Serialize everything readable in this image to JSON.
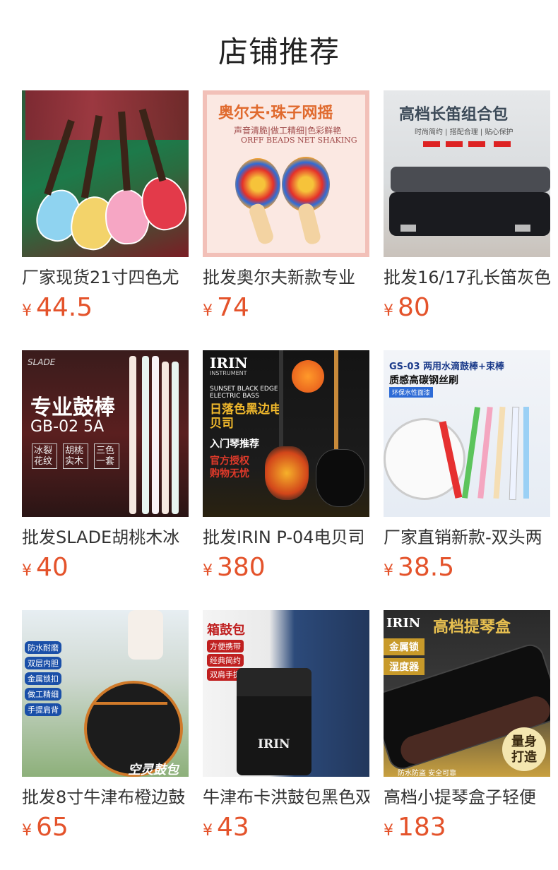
{
  "header": {
    "title": "店铺推荐"
  },
  "currency": "¥",
  "products": [
    {
      "name": "厂家现货21寸四色尤",
      "price": "44.5"
    },
    {
      "name": "批发奥尔夫新款专业",
      "price": "74",
      "image_text": {
        "headline": "奥尔夫·珠子网摇",
        "sub": "声音清脆|做工精细|色彩鲜艳",
        "en": "ORFF BEADS NET SHAKING"
      }
    },
    {
      "name": "批发16/17孔长笛灰色",
      "price": "80",
      "image_text": {
        "headline": "高档长笛组合包",
        "sub": "时尚简约 | 搭配合理 | 贴心保护"
      }
    },
    {
      "name": "批发SLADE胡桃木冰",
      "price": "40",
      "image_text": {
        "brand": "SLADE",
        "headline": "专业鼓棒",
        "model": "GB-02 5A",
        "tags": [
          "冰裂花纹",
          "胡桃实木",
          "三色一套"
        ]
      }
    },
    {
      "name": "批发IRIN P-04电贝司",
      "price": "380",
      "image_text": {
        "brand": "IRIN",
        "brand_sub": "INSTRUMENT",
        "en1": "SUNSET BLACK EDGE",
        "en2": "ELECTRIC BASS",
        "headline": "日落色黑边电贝司",
        "tag": "入门琴推荐",
        "note": "官方授权 购物无忧"
      }
    },
    {
      "name": "厂家直销新款-双头两",
      "price": "38.5",
      "image_text": {
        "headline": "GS-03 两用水滴鼓棒+束棒",
        "sub": "质感高碳钢丝刷",
        "tag": "环保水性面漆"
      }
    },
    {
      "name": "批发8寸牛津布橙边鼓",
      "price": "65",
      "image_text": {
        "tags": [
          "防水耐磨",
          "双层内胆",
          "金属锁扣",
          "做工精细",
          "手提肩背"
        ],
        "brand": "空灵鼓包"
      }
    },
    {
      "name": "牛津布卡洪鼓包黑色双",
      "price": "43",
      "image_text": {
        "headline": "箱鼓包",
        "tags": [
          "方便携带",
          "经典简约",
          "双肩手提"
        ],
        "brand": "IRIN"
      }
    },
    {
      "name": "高档小提琴盒子轻便",
      "price": "183",
      "image_text": {
        "brand": "IRIN",
        "headline": "高档提琴盒",
        "tags": [
          "金属锁",
          "湿度器"
        ],
        "badge": "量身打造",
        "foot": "防水防盗  安全可靠"
      }
    }
  ]
}
